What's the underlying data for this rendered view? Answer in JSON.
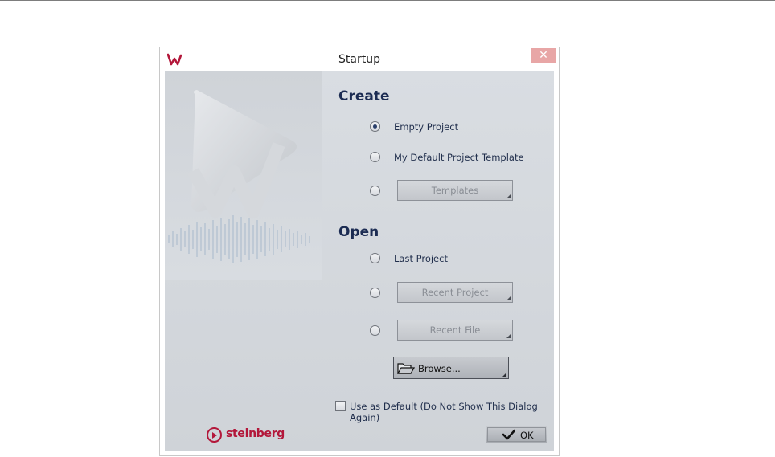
{
  "window": {
    "title": "Startup",
    "close_glyph": "✕",
    "icon": "wavelab-logo-icon"
  },
  "create": {
    "heading": "Create",
    "options": [
      {
        "label": "Empty Project",
        "selected": true
      },
      {
        "label": "My Default Project Template",
        "selected": false
      },
      {
        "label": "",
        "selected": false,
        "button": "Templates"
      }
    ]
  },
  "open": {
    "heading": "Open",
    "options": [
      {
        "label": "Last Project",
        "selected": false
      },
      {
        "label": "",
        "selected": false,
        "button": "Recent Project"
      },
      {
        "label": "",
        "selected": false,
        "button": "Recent File"
      }
    ],
    "browse_label": "Browse..."
  },
  "footer": {
    "use_default_label": "Use as Default (Do Not Show This Dialog Again)",
    "use_default_checked": false,
    "brand": "steinberg",
    "ok_label": "OK"
  },
  "colors": {
    "heading": "#1c2c53",
    "brand": "#b3173a",
    "close": "#e8a6a6"
  }
}
